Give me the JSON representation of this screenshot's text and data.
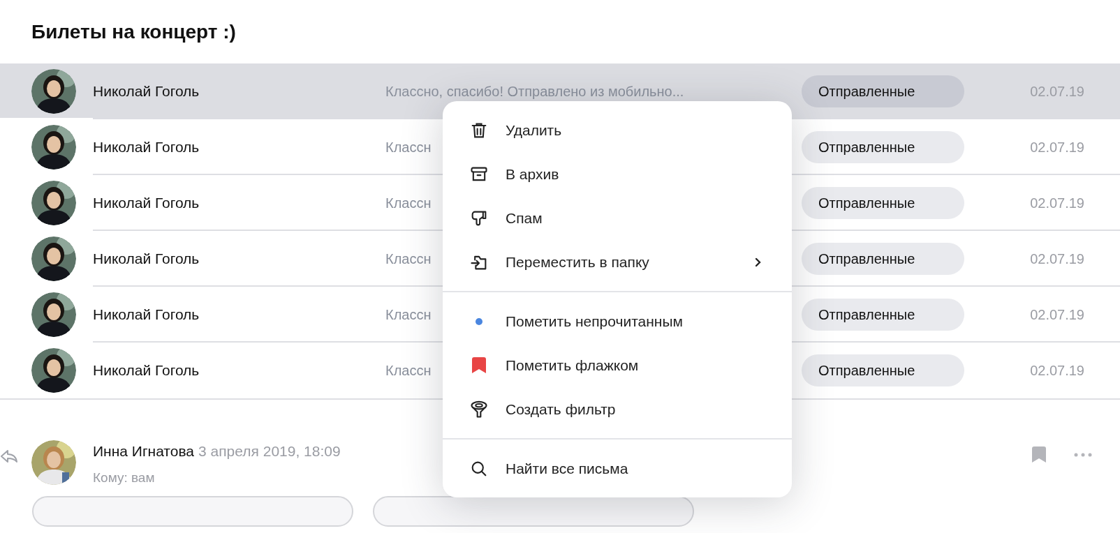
{
  "thread_title": "Билеты на концерт :)",
  "messages": [
    {
      "sender": "Николай Гоголь",
      "preview": "Классно, спасибо! Отправлено из мобильно...",
      "folder": "Отправленные",
      "date": "02.07.19",
      "selected": true
    },
    {
      "sender": "Николай Гоголь",
      "preview": "Классн",
      "folder": "Отправленные",
      "date": "02.07.19",
      "selected": false
    },
    {
      "sender": "Николай Гоголь",
      "preview": "Классн",
      "folder": "Отправленные",
      "date": "02.07.19",
      "selected": false
    },
    {
      "sender": "Николай Гоголь",
      "preview": "Классн",
      "folder": "Отправленные",
      "date": "02.07.19",
      "selected": false
    },
    {
      "sender": "Николай Гоголь",
      "preview": "Классн",
      "folder": "Отправленные",
      "date": "02.07.19",
      "selected": false
    },
    {
      "sender": "Николай Гоголь",
      "preview": "Классн",
      "folder": "Отправленные",
      "date": "02.07.19",
      "selected": false
    }
  ],
  "open_message": {
    "sender": "Инна Игнатова",
    "date": "3 апреля 2019, 18:09",
    "recipient": "Кому: вам"
  },
  "context_menu": {
    "groups": [
      [
        {
          "label": "Удалить",
          "submenu": false
        },
        {
          "label": "В архив",
          "submenu": false
        },
        {
          "label": "Спам",
          "submenu": false
        },
        {
          "label": "Переместить в папку",
          "submenu": true
        }
      ],
      [
        {
          "label": "Пометить непрочитанным",
          "submenu": false,
          "color": "#4a86e0"
        },
        {
          "label": "Пометить флажком",
          "submenu": false,
          "color": "#e84545"
        },
        {
          "label": "Создать фильтр",
          "submenu": false
        }
      ],
      [
        {
          "label": "Найти все письма",
          "submenu": false
        }
      ]
    ]
  }
}
